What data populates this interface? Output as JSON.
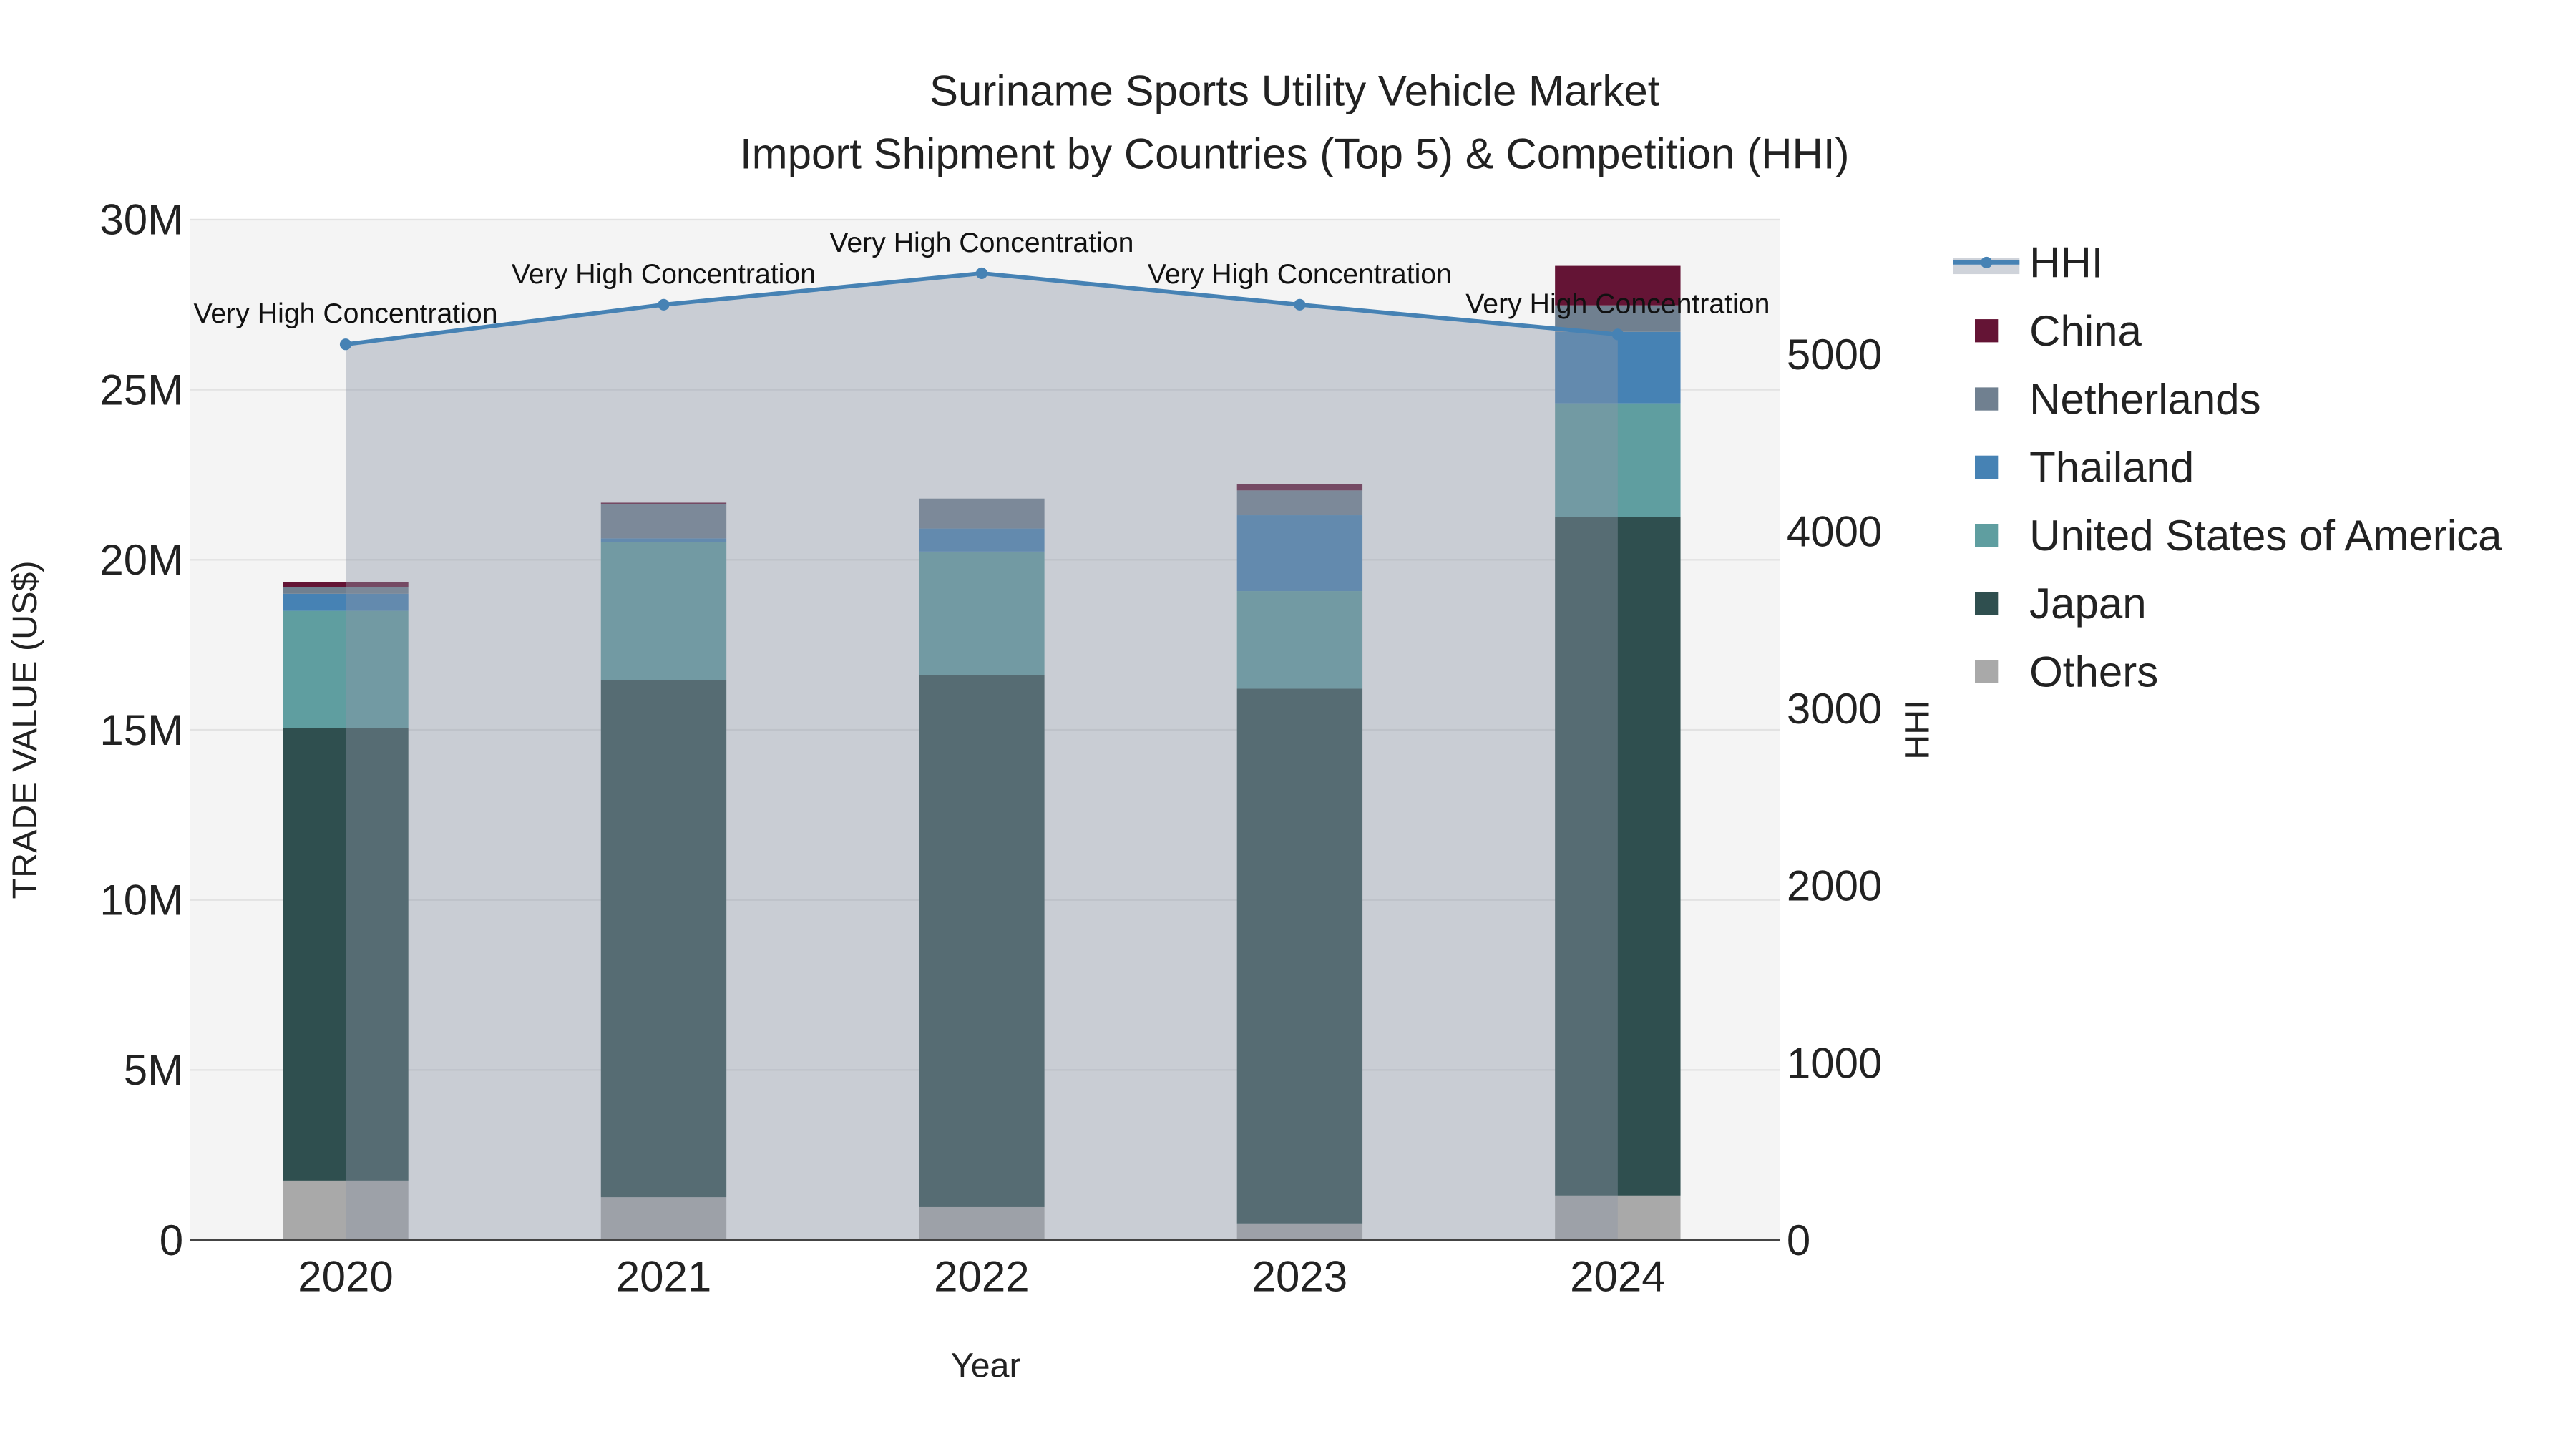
{
  "chart_data": {
    "type": "bar",
    "title_line1": "Suriname Sports Utility Vehicle Market",
    "title_line2": "Import Shipment by Countries (Top 5) & Competition (HHI)",
    "xlabel": "Year",
    "ylabel": "TRADE VALUE (US$)",
    "y2label": "HHI",
    "categories": [
      "2020",
      "2021",
      "2022",
      "2023",
      "2024"
    ],
    "ylim": [
      0,
      30000000
    ],
    "y_ticks": [
      0,
      5000000,
      10000000,
      15000000,
      20000000,
      25000000,
      30000000
    ],
    "y_tick_labels": [
      "0",
      "5M",
      "10M",
      "15M",
      "20M",
      "25M",
      "30M"
    ],
    "y2_ticks": [
      0,
      1000,
      2000,
      3000,
      4000,
      5000
    ],
    "y2_tick_labels": [
      "0",
      "1000",
      "2000",
      "3000",
      "4000",
      "5000"
    ],
    "stacked": true,
    "series": [
      {
        "name": "Others",
        "color": "#a9a9a9",
        "values": [
          1750000,
          1260000,
          970000,
          490000,
          1310000
        ]
      },
      {
        "name": "Japan",
        "color": "#2f4f4f",
        "values": [
          13300000,
          15200000,
          15630000,
          15720000,
          19950000
        ]
      },
      {
        "name": "United States of America",
        "color": "#5f9ea0",
        "values": [
          3450000,
          4070000,
          3640000,
          2870000,
          3340000
        ]
      },
      {
        "name": "Thailand",
        "color": "#4682b4",
        "values": [
          500000,
          100000,
          680000,
          2230000,
          2100000
        ]
      },
      {
        "name": "Netherlands",
        "color": "#708090",
        "values": [
          200000,
          1000000,
          880000,
          730000,
          780000
        ]
      },
      {
        "name": "China",
        "color": "#641435",
        "values": [
          150000,
          50000,
          0,
          190000,
          1160000
        ]
      }
    ],
    "hhi": {
      "name": "HHI",
      "color": "#4682b4",
      "values": [
        5056,
        5280,
        5457,
        5280,
        5112
      ],
      "annotations": [
        "Very High Concentration",
        "Very High Concentration",
        "Very High Concentration",
        "Very High Concentration",
        "Very High Concentration"
      ],
      "ylim": [
        0,
        5760
      ]
    },
    "legend": [
      "HHI",
      "China",
      "Netherlands",
      "Thailand",
      "United States of America",
      "Japan",
      "Others"
    ],
    "legend_position": "right",
    "grid": true
  }
}
